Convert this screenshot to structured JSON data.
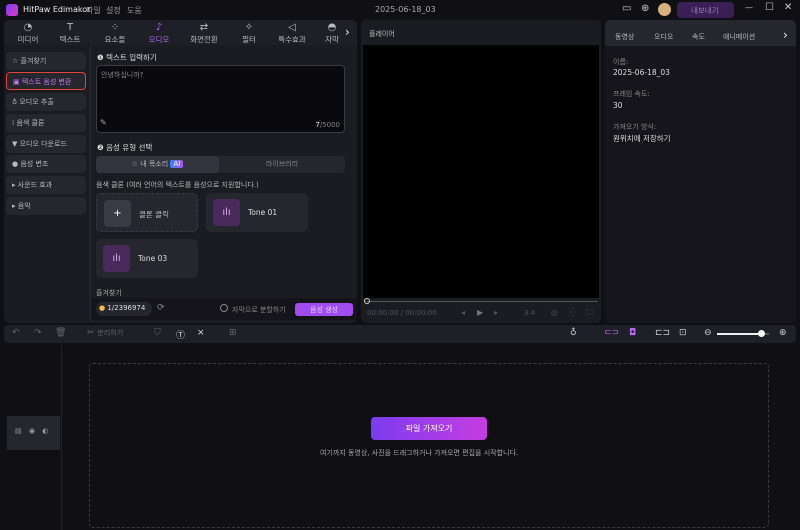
{
  "app": {
    "title": "HitPaw Edimakor",
    "menus": [
      "파일",
      "설정",
      "도움"
    ],
    "project_name": "2025-06-18_03",
    "export_label": "내보내기"
  },
  "toolbar_tabs": [
    {
      "label": "미디어",
      "icon": "media-icon"
    },
    {
      "label": "텍스트",
      "icon": "text-icon"
    },
    {
      "label": "요소들",
      "icon": "elements-icon"
    },
    {
      "label": "오디오",
      "icon": "music-note-icon"
    },
    {
      "label": "화면전환",
      "icon": "transition-icon"
    },
    {
      "label": "필터",
      "icon": "filter-icon"
    },
    {
      "label": "특수효과",
      "icon": "effects-icon"
    },
    {
      "label": "자막",
      "icon": "subtitle-icon"
    }
  ],
  "sidebar": [
    {
      "label": "즐겨찾기",
      "icon": "star-icon"
    },
    {
      "label": "텍스트 음성 변환",
      "icon": "tts-icon"
    },
    {
      "label": "오디오 추출",
      "icon": "mic-icon"
    },
    {
      "label": "음색 클론",
      "icon": "waveform-icon"
    },
    {
      "label": "오디오 다운로드",
      "icon": "download-icon"
    },
    {
      "label": "음성 변조",
      "icon": "voice-changer-icon"
    },
    {
      "label": "사운드 효과",
      "icon": "caret-right-icon"
    },
    {
      "label": "음악",
      "icon": "caret-right-icon"
    }
  ],
  "tts": {
    "step1": "텍스트 입력하기",
    "text_value": "안녕하십니까?",
    "char_count": "7",
    "char_max": "/5000",
    "step2": "음성 유형 선택",
    "voice_tabs": [
      "내 목소리",
      "라이브러리"
    ],
    "ai_badge": "AI",
    "clone_desc": "음색 클론 (여러 언어의 텍스트를 음성으로 지원합니다.)",
    "clone_click": "클론 클릭",
    "tones": [
      "Tone 01",
      "Tone 03"
    ],
    "favorites": "즐겨찾기",
    "credits": "1/2396974",
    "split_label": "자막으로 분할하기",
    "generate": "음성 생성"
  },
  "player": {
    "title": "플레이어",
    "time": "00:00:00",
    "duration": "/ 00:00:00",
    "ratio": "3:4"
  },
  "right": {
    "tabs": [
      "동영상",
      "오디오",
      "속도",
      "애니메이션"
    ],
    "name_label": "이름:",
    "name_value": "2025-06-18_03",
    "fps_label": "프레임 속도:",
    "fps_value": "30",
    "import_label": "가져오기 방식:",
    "import_value": "원위치에 저장하기"
  },
  "timeline": {
    "split": "분리하기",
    "import_button": "파일 가져오기",
    "hint": "여기까지 동영상, 사진을 드래그하거나 가져오면 편집을 시작합니다.",
    "zoom": 0.85
  },
  "colors": {
    "accent": "#a855f7",
    "selected_border": "#e0443a"
  }
}
